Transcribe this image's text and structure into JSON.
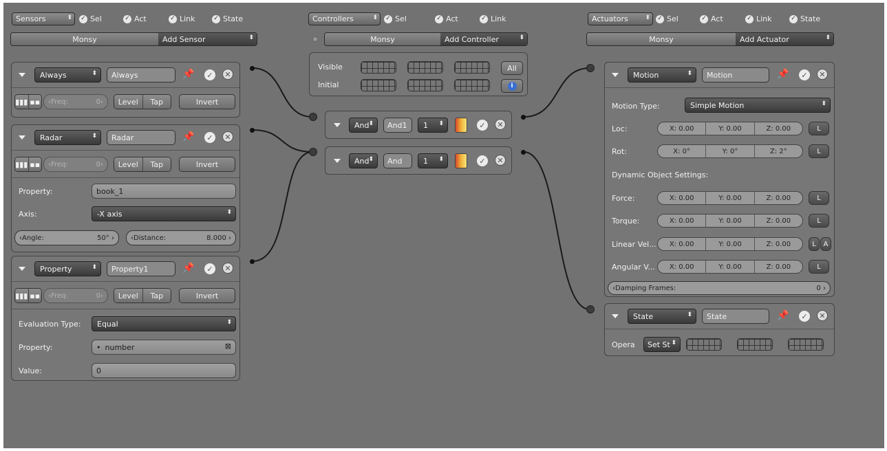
{
  "sensors_header": {
    "menu": "Sensors",
    "sel": "Sel",
    "act": "Act",
    "link": "Link",
    "state": "State",
    "object": "Monsy",
    "add": "Add Sensor"
  },
  "controllers_header": {
    "menu": "Controllers",
    "sel": "Sel",
    "act": "Act",
    "link": "Link",
    "object": "Monsy",
    "add": "Add Controller",
    "visible_label": "Visible",
    "initial_label": "Initial",
    "all_label": "All",
    "info_icon": "i"
  },
  "actuators_header": {
    "menu": "Actuators",
    "sel": "Sel",
    "act": "Act",
    "link": "Link",
    "state": "State",
    "object": "Monsy",
    "add": "Add Actuator"
  },
  "sensors": [
    {
      "type": "Always",
      "name": "Always",
      "freq_label": "Freq:",
      "freq": "0",
      "level": "Level",
      "tap": "Tap",
      "invert": "Invert"
    },
    {
      "type": "Radar",
      "name": "Radar",
      "freq_label": "Freq:",
      "freq": "0",
      "level": "Level",
      "tap": "Tap",
      "invert": "Invert",
      "property_label": "Property:",
      "property": "book_1",
      "axis_label": "Axis:",
      "axis": "-X axis",
      "angle_label": "Angle:",
      "angle": "50°",
      "distance_label": "Distance:",
      "distance": "8.000"
    },
    {
      "type": "Property",
      "name": "Property1",
      "freq_label": "Freq:",
      "freq": "0",
      "level": "Level",
      "tap": "Tap",
      "invert": "Invert",
      "eval_label": "Evaluation Type:",
      "eval": "Equal",
      "property_label": "Property:",
      "property": "number",
      "value_label": "Value:",
      "value": "0"
    }
  ],
  "controllers": [
    {
      "type": "And",
      "name": "And1",
      "state": "1"
    },
    {
      "type": "And",
      "name": "And",
      "state": "1"
    }
  ],
  "motion": {
    "type": "Motion",
    "name": "Motion",
    "motion_type_label": "Motion Type:",
    "motion_type": "Simple Motion",
    "loc_label": "Loc:",
    "loc": [
      "X: 0.00",
      "Y: 0.00",
      "Z: 0.00"
    ],
    "rot_label": "Rot:",
    "rot": [
      "X: 0°",
      "Y: 0°",
      "Z: 2°"
    ],
    "dyn_label": "Dynamic Object Settings:",
    "force_label": "Force:",
    "force": [
      "X: 0.00",
      "Y: 0.00",
      "Z: 0.00"
    ],
    "torque_label": "Torque:",
    "torque": [
      "X: 0.00",
      "Y: 0.00",
      "Z: 0.00"
    ],
    "linvel_label": "Linear Vel...",
    "linvel": [
      "X: 0.00",
      "Y: 0.00",
      "Z: 0.00"
    ],
    "angvel_label": "Angular V...",
    "angvel": [
      "X: 0.00",
      "Y: 0.00",
      "Z: 0.00"
    ],
    "damping_label": "Damping Frames:",
    "damping": "0",
    "L": "L",
    "A": "A"
  },
  "state_actuator": {
    "type": "State",
    "name": "State",
    "opera_label": "Opera",
    "opera": "Set St"
  }
}
